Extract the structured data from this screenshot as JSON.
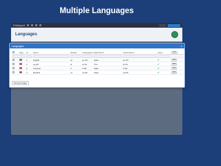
{
  "headline": "Multiple Languages",
  "app": {
    "brand": "FlatAgent",
    "page_title": "Languages"
  },
  "modal": {
    "title": "Languages",
    "close_glyph": "×"
  },
  "grid": {
    "headers": {
      "flag": "Flag",
      "id": "Id",
      "name": "Name",
      "default": "Default",
      "lcode": "LanguageCode",
      "rtl": "RightToLeft",
      "culture": "CultureName",
      "active": "Active",
      "add": "Add"
    },
    "rows": [
      {
        "id": "1",
        "name": "English",
        "default": "en",
        "lcode": "en-US",
        "rtl": "False",
        "culture": "en-US",
        "active": true,
        "edit": "Edit"
      },
      {
        "id": "2",
        "name": "العربية",
        "default": "ar",
        "lcode": "ar-SA",
        "rtl": "True",
        "culture": "ar-SA",
        "active": true,
        "edit": "Edit"
      },
      {
        "id": "3",
        "name": "Français",
        "default": "fr",
        "lcode": "fr-FR",
        "rtl": "False",
        "culture": "fr-FR",
        "active": true,
        "edit": "Edit"
      },
      {
        "id": "4",
        "name": "Español",
        "default": "es",
        "lcode": "es-ES",
        "rtl": "False",
        "culture": "es-ES",
        "active": true,
        "edit": "Edit"
      }
    ]
  },
  "pager": {
    "label": "Items per page"
  },
  "colors": {
    "background": "#1c3f7a",
    "modal_header": "#2e74c9",
    "active_tick": "#2f8f5b"
  },
  "icons": {
    "active": "check-icon",
    "new": "plus-circle-icon"
  }
}
